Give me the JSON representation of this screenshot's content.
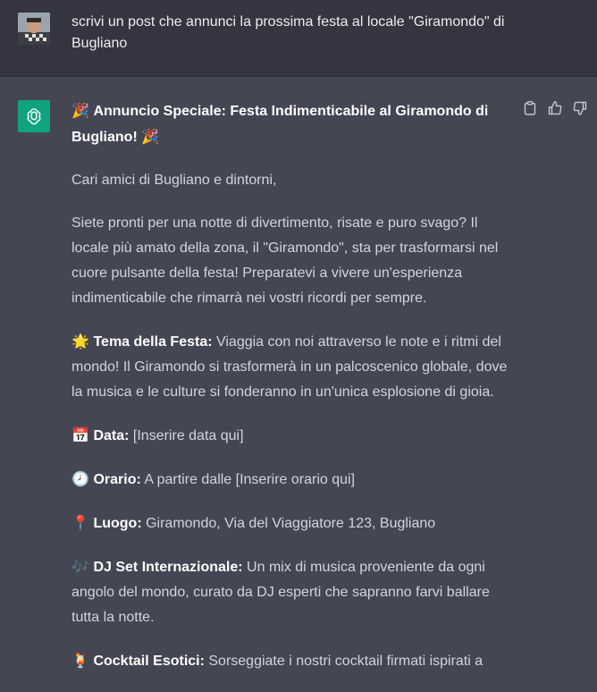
{
  "user": {
    "prompt": "scrivi un post che annunci la prossima festa al locale \"Giramondo\" di Bugliano"
  },
  "assistant": {
    "title_emoji_start": "🎉",
    "title": "Annuncio Speciale: Festa Indimenticabile al Giramondo di Bugliano!",
    "title_emoji_end": "🎉",
    "greeting": "Cari amici di Bugliano e dintorni,",
    "intro": "Siete pronti per una notte di divertimento, risate e puro svago? Il locale più amato della zona, il \"Giramondo\", sta per trasformarsi nel cuore pulsante della festa! Preparatevi a vivere un'esperienza indimenticabile che rimarrà nei vostri ricordi per sempre.",
    "items": [
      {
        "emoji": "🌟",
        "label": "Tema della Festa:",
        "text": " Viaggia con noi attraverso le note e i ritmi del mondo! Il Giramondo si trasformerà in un palcoscenico globale, dove la musica e le culture si fonderanno in un'unica esplosione di gioia."
      },
      {
        "emoji": "📅",
        "label": "Data:",
        "text": " [Inserire data qui]"
      },
      {
        "emoji": "🕗",
        "label": "Orario:",
        "text": " A partire dalle [Inserire orario qui]"
      },
      {
        "emoji": "📍",
        "label": "Luogo:",
        "text": " Giramondo, Via del Viaggiatore 123, Bugliano"
      },
      {
        "emoji": "🎶",
        "label": "DJ Set Internazionale:",
        "text": " Un mix di musica proveniente da ogni angolo del mondo, curato da DJ esperti che sapranno farvi ballare tutta la notte."
      },
      {
        "emoji": "🍹",
        "label": "Cocktail Esotici:",
        "text": " Sorseggiate i nostri cocktail firmati ispirati a"
      }
    ]
  },
  "icons": {
    "copy": "clipboard-icon",
    "thumbs_up": "thumbs-up-icon",
    "thumbs_down": "thumbs-down-icon",
    "logo": "openai-logo-icon"
  },
  "colors": {
    "user_bg": "#343541",
    "assistant_bg": "#444654",
    "avatar_green": "#10a37f"
  }
}
